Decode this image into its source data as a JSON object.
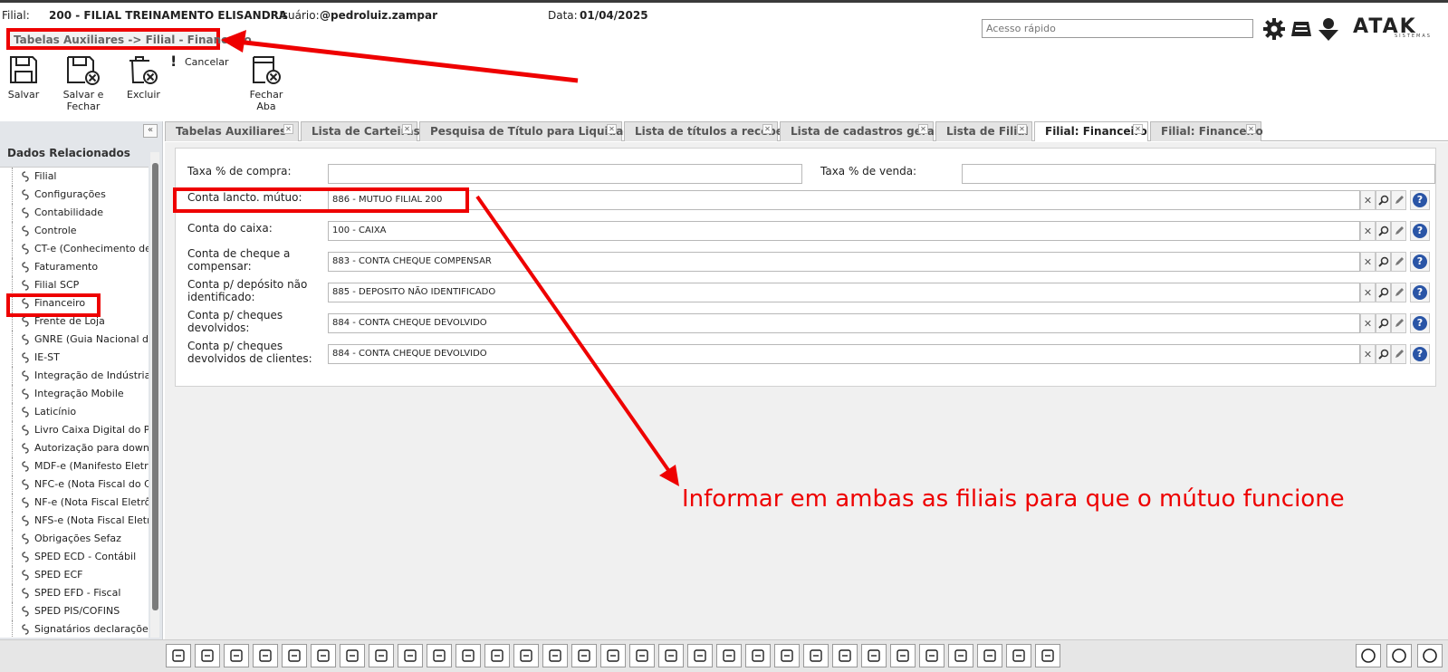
{
  "header": {
    "filial_label": "Filial:",
    "filial_value": "200 - FILIAL TREINAMENTO ELISANDRA",
    "usuario_label": "Usuário:",
    "usuario_value": "@pedroluiz.zampar",
    "data_label": "Data:",
    "data_value": "01/04/2025",
    "quick_access_placeholder": "Acesso rápido",
    "logo": "ATAK",
    "logo_sub": "SISTEMAS"
  },
  "breadcrumb": "Tabelas Auxiliares -> Filial - Financeiro",
  "toolbar": {
    "save": "Salvar",
    "save_close": "Salvar e Fechar",
    "delete": "Excluir",
    "cancel": "Cancelar",
    "close_tab": "Fechar Aba"
  },
  "left_panel": {
    "title": "Dados Relacionados",
    "collapse_glyph": "«",
    "items": [
      "Filial",
      "Configurações",
      "Contabilidade",
      "Controle",
      "CT-e (Conhecimento de T",
      "Faturamento",
      "Filial SCP",
      "Financeiro",
      "Frente de Loja",
      "GNRE (Guia Nacional de F",
      "IE-ST",
      "Integração de Indústria",
      "Integração Mobile",
      "Laticínio",
      "Livro Caixa Digital do Proc",
      "Autorização para downloa",
      "MDF-e (Manifesto Eletrôn",
      "NFC-e (Nota Fiscal do Con",
      "NF-e (Nota Fiscal Eletrôni",
      "NFS-e (Nota Fiscal Eletrôn",
      "Obrigações Sefaz",
      "SPED ECD - Contábil",
      "SPED ECF",
      "SPED EFD - Fiscal",
      "SPED PIS/COFINS",
      "Signatários declarações"
    ]
  },
  "tabs": [
    "Tabelas Auxiliares",
    "Lista de Carteiras",
    "Pesquisa de Título para Liquidação",
    "Lista de títulos a receber",
    "Lista de cadastros gerais",
    "Lista de Filial",
    "Filial: Financeiro",
    "Filial: Financeiro"
  ],
  "active_tab_index": 6,
  "form": {
    "taxa_compra_label": "Taxa % de compra:",
    "taxa_compra_value": "",
    "taxa_venda_label": "Taxa % de venda:",
    "taxa_venda_value": "",
    "rows": [
      {
        "label1": "Conta lancto. mútuo:",
        "label2": "",
        "value": "886 - MUTUO FILIAL 200"
      },
      {
        "label1": "Conta do caixa:",
        "label2": "",
        "value": "100 - CAIXA"
      },
      {
        "label1": "Conta de cheque a",
        "label2": "compensar:",
        "value": "883 - CONTA CHEQUE COMPENSAR"
      },
      {
        "label1": "Conta p/ depósito não",
        "label2": "identificado:",
        "value": "885 - DEPOSITO NÃO IDENTIFICADO"
      },
      {
        "label1": "Conta p/ cheques",
        "label2": "devolvidos:",
        "value": "884 - CONTA CHEQUE DEVOLVIDO"
      },
      {
        "label1": "Conta p/ cheques",
        "label2": "devolvidos de clientes:",
        "value": "884 - CONTA CHEQUE DEVOLVIDO"
      }
    ]
  },
  "annotation": "Informar em ambas as filiais para que o mútuo funcione",
  "colors": {
    "highlight": "#e00000",
    "help_blue": "#2a55a6"
  }
}
